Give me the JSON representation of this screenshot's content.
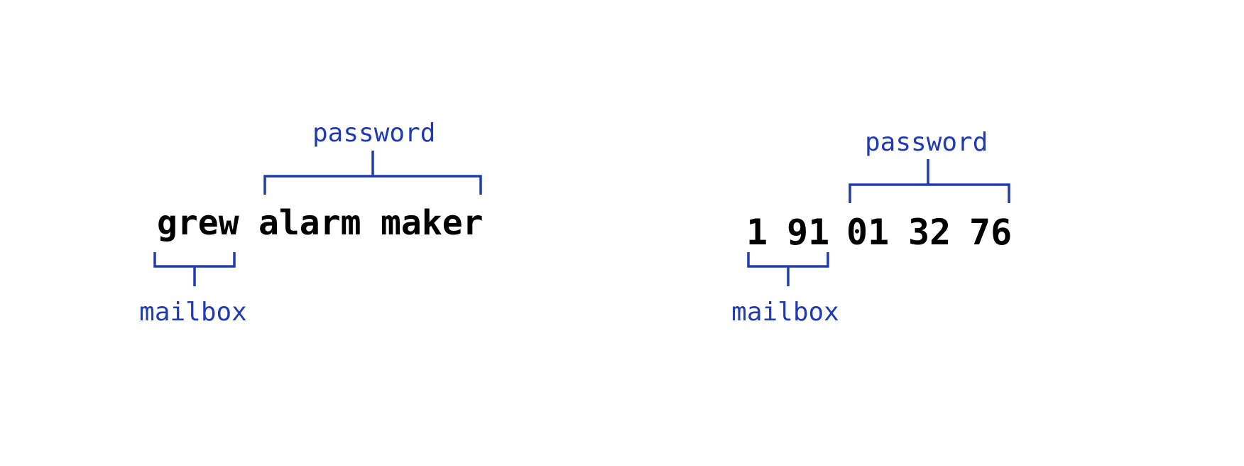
{
  "colors": {
    "annotation": "#1f3bb3",
    "text": "#000000",
    "background": "#ffffff"
  },
  "examples": [
    {
      "words": [
        "grew",
        "alarm",
        "maker"
      ],
      "mailbox_label": "mailbox",
      "password_label": "password"
    },
    {
      "words": [
        "1",
        "91",
        "01",
        "32",
        "76"
      ],
      "mailbox_label": "mailbox",
      "password_label": "password"
    }
  ]
}
